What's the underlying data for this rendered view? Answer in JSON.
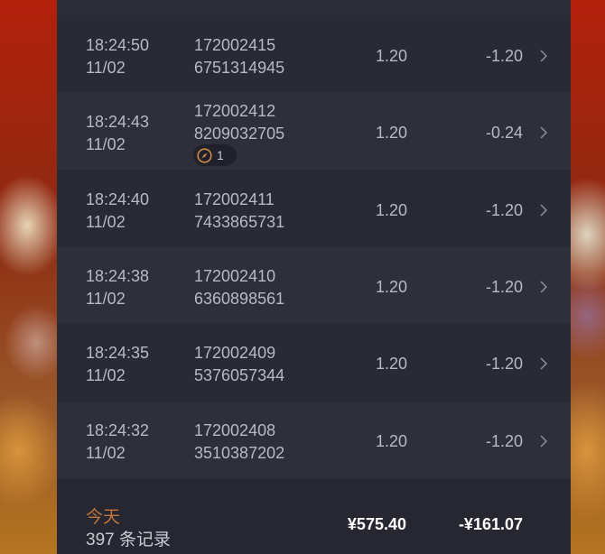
{
  "records": [
    {
      "time": "18:24:50",
      "date": "11/02",
      "order_line1": "172002415",
      "order_line2": "6751314945",
      "price": "1.20",
      "amount": "-1.20"
    },
    {
      "time": "18:24:43",
      "date": "11/02",
      "order_line1": "172002412",
      "order_line2": "8209032705",
      "price": "1.20",
      "amount": "-0.24",
      "badge_count": "1"
    },
    {
      "time": "18:24:40",
      "date": "11/02",
      "order_line1": "172002411",
      "order_line2": "7433865731",
      "price": "1.20",
      "amount": "-1.20"
    },
    {
      "time": "18:24:38",
      "date": "11/02",
      "order_line1": "172002410",
      "order_line2": "6360898561",
      "price": "1.20",
      "amount": "-1.20"
    },
    {
      "time": "18:24:35",
      "date": "11/02",
      "order_line1": "172002409",
      "order_line2": "5376057344",
      "price": "1.20",
      "amount": "-1.20"
    },
    {
      "time": "18:24:32",
      "date": "11/02",
      "order_line1": "172002408",
      "order_line2": "3510387202",
      "price": "1.20",
      "amount": "-1.20"
    }
  ],
  "summary": {
    "today_label": "今天",
    "record_count": "397 条记录",
    "total": "¥575.40",
    "net": "-¥161.07"
  },
  "colors": {
    "panel": "#272832",
    "row_light": "#2e2f3a",
    "row_dark": "#292a34",
    "text": "#b7b9c4",
    "accent_today": "#c2763b"
  },
  "icons": {
    "row_chevron": "chevron-right-icon",
    "badge": "compass-icon"
  }
}
